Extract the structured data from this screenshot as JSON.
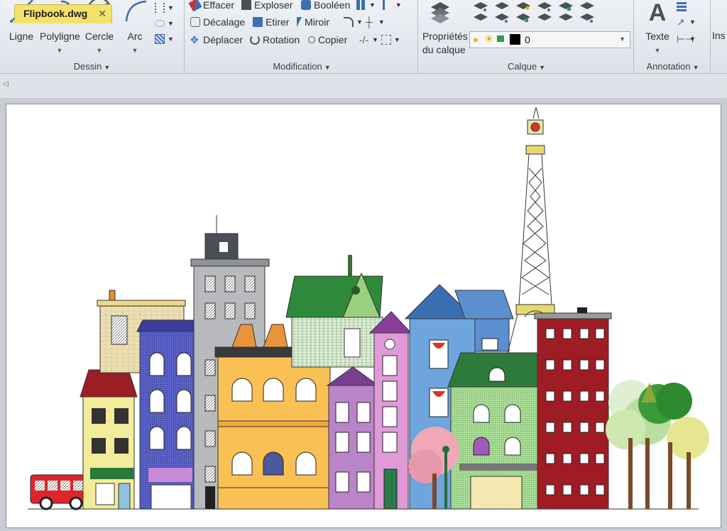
{
  "ribbon": {
    "dessin": {
      "title": "Dessin",
      "tools": [
        {
          "name": "ligne",
          "label": "Ligne"
        },
        {
          "name": "polyligne",
          "label": "Polyligne"
        },
        {
          "name": "cercle",
          "label": "Cercle"
        },
        {
          "name": "arc",
          "label": "Arc"
        }
      ]
    },
    "modification": {
      "title": "Modification",
      "col1": [
        "Effacer",
        "Décalage",
        "Déplacer"
      ],
      "col2": [
        "Exploser",
        "Etirer",
        "Rotation"
      ],
      "col3": [
        "Booléen",
        "Miroir",
        "Copier"
      ]
    },
    "calque": {
      "title": "Calque",
      "props_label_1": "Propriétés",
      "props_label_2": "du calque",
      "current_layer": "0"
    },
    "annotation": {
      "title": "Annotation",
      "texte_label": "Texte"
    },
    "insert": {
      "label": "Ins"
    }
  },
  "tabs": {
    "active_file": "Flipbook.dwg",
    "close_glyph": "✕"
  },
  "colors": {
    "tab_active": "#f4e26a",
    "ribbon_bg": "#e6eaef",
    "canvas_bg": "#ffffff",
    "layer_swatch": "#000000"
  }
}
